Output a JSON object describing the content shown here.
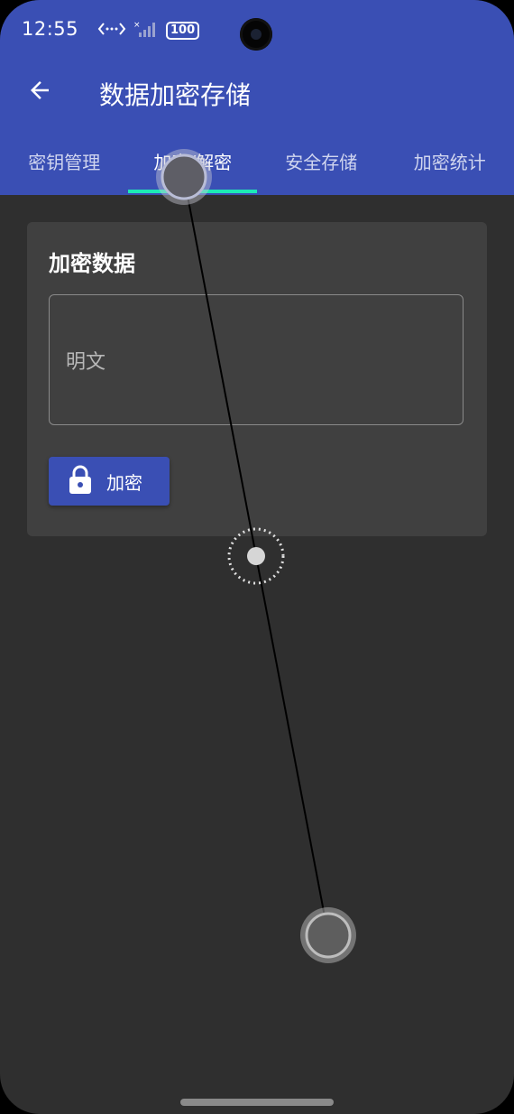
{
  "status_bar": {
    "time": "12:55",
    "battery": "100"
  },
  "toolbar": {
    "title": "数据加密存储"
  },
  "tabs": [
    {
      "label": "密钥管理"
    },
    {
      "label": "加密/解密"
    },
    {
      "label": "安全存储"
    },
    {
      "label": "加密统计"
    }
  ],
  "active_tab": "加密/解密",
  "card": {
    "title": "加密数据",
    "input_placeholder": "明文",
    "encrypt_button_label": "加密"
  },
  "colors": {
    "app_bar": "#3a4fb4",
    "tab_indicator": "#1de9b6",
    "background": "#2f2f2f",
    "card": "#404040"
  },
  "icons": [
    "arrow-back-icon",
    "lock-icon",
    "data-transfer-icon",
    "signal-icon",
    "battery-icon"
  ]
}
